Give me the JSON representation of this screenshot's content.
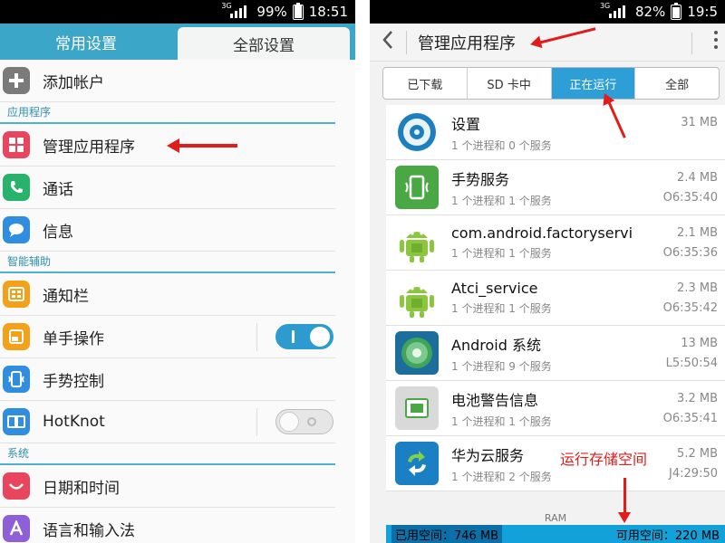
{
  "left": {
    "status": {
      "network": "3G",
      "battery": "99%",
      "time": "18:51"
    },
    "tabs": [
      {
        "label": "常用设置"
      },
      {
        "label": "全部设置"
      }
    ],
    "items": [
      {
        "label": "添加帐户",
        "icon": "add-icon",
        "color": "#7a7a7a"
      },
      {
        "section": "应用程序"
      },
      {
        "label": "管理应用程序",
        "icon": "apps-grid-icon",
        "color": "#e8455e"
      },
      {
        "label": "通话",
        "icon": "phone-icon",
        "color": "#27b36b"
      },
      {
        "label": "信息",
        "icon": "message-icon",
        "color": "#2f8ee0"
      },
      {
        "section": "智能辅助"
      },
      {
        "label": "通知栏",
        "icon": "notification-icon",
        "color": "#f2a118"
      },
      {
        "label": "单手操作",
        "icon": "one-hand-icon",
        "color": "#f2a118",
        "toggle": "on"
      },
      {
        "label": "手势控制",
        "icon": "gesture-icon",
        "color": "#2f8ee0"
      },
      {
        "label": "HotKnot",
        "icon": "hotknot-icon",
        "color": "#2f8ee0",
        "toggle": "off"
      },
      {
        "section": "系统"
      },
      {
        "label": "日期和时间",
        "icon": "calendar-icon",
        "color": "#e8455e"
      },
      {
        "label": "语言和输入法",
        "icon": "language-icon",
        "color": "#8e5fd6"
      }
    ]
  },
  "right": {
    "status": {
      "network": "3G",
      "battery": "82%",
      "time": "19:5"
    },
    "title": "管理应用程序",
    "segments": [
      "已下载",
      "SD 卡中",
      "正在运行",
      "全部"
    ],
    "active_segment": "正在运行",
    "apps": [
      {
        "name": "设置",
        "sub": "1 个进程和 0 个服务",
        "size": "31 MB",
        "time": "",
        "icon": "settings-icon"
      },
      {
        "name": "手势服务",
        "sub": "1 个进程和 1 个服务",
        "size": "2.4 MB",
        "time": "O6:35:40",
        "icon": "gesture-service-icon"
      },
      {
        "name": "com.android.factoryservi",
        "sub": "1 个进程和 1 个服务",
        "size": "2.1 MB",
        "time": "O6:35:36",
        "icon": "android-icon"
      },
      {
        "name": "Atci_service",
        "sub": "1 个进程和 1 个服务",
        "size": "2.3 MB",
        "time": "O6:35:42",
        "icon": "android-icon"
      },
      {
        "name": "Android 系统",
        "sub": "1 个进程和 9 个服务",
        "size": "13 MB",
        "time": "L5:50:54",
        "icon": "android-system-icon"
      },
      {
        "name": "电池警告信息",
        "sub": "1 个进程和 1 个服务",
        "size": "3.2 MB",
        "time": "O6:35:41",
        "icon": "battery-warning-icon"
      },
      {
        "name": "华为云服务",
        "sub": "1 个进程和 2 个服务",
        "size": "5.2 MB",
        "time": "J4:29:50",
        "icon": "cloud-sync-icon"
      }
    ],
    "annotation": "运行存储空间",
    "ram_label": "RAM",
    "used": "已用空间：746 MB",
    "free": "可用空间：220 MB"
  }
}
